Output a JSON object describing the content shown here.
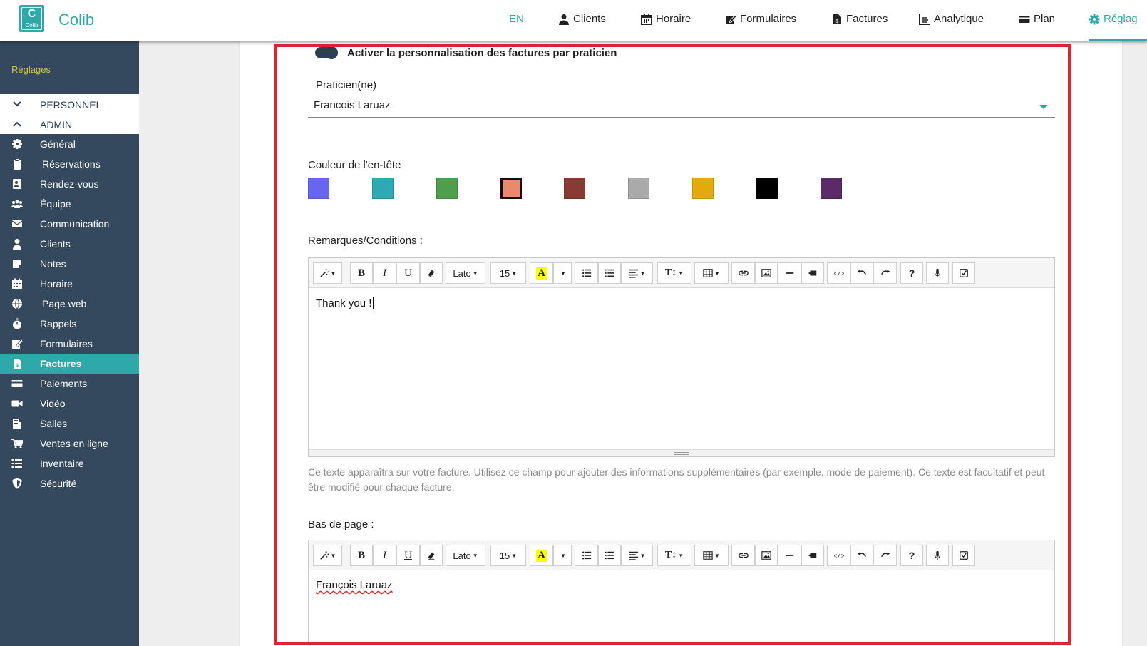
{
  "app": {
    "brand": "Colib",
    "logo_letter": "C",
    "logo_text": "Colib",
    "accent": "#2ea8a9",
    "sidebar_bg": "#34495e",
    "highlight_border": "#e0232e"
  },
  "nav": {
    "lang": "EN",
    "items": [
      {
        "label": "Clients",
        "icon": "user-icon"
      },
      {
        "label": "Horaire",
        "icon": "calendar-icon"
      },
      {
        "label": "Formulaires",
        "icon": "form-edit-icon"
      },
      {
        "label": "Factures",
        "icon": "invoice-icon"
      },
      {
        "label": "Analytique",
        "icon": "chart-line-icon"
      },
      {
        "label": "Plan",
        "icon": "credit-card-icon"
      },
      {
        "label": "Réglag",
        "icon": "gear-icon"
      }
    ]
  },
  "sidebar": {
    "title": "Réglages",
    "groups": [
      {
        "label": "PERSONNEL",
        "icon": "chevron-down-icon"
      },
      {
        "label": "ADMIN",
        "icon": "chevron-up-icon"
      }
    ],
    "items": [
      {
        "label": "Général",
        "icon": "gear-icon"
      },
      {
        "label": "Réservations",
        "icon": "clipboard-icon"
      },
      {
        "label": "Rendez-vous",
        "icon": "address-card-icon"
      },
      {
        "label": "Équipe",
        "icon": "users-icon"
      },
      {
        "label": "Communication",
        "icon": "envelope-icon"
      },
      {
        "label": "Clients",
        "icon": "user-icon"
      },
      {
        "label": "Notes",
        "icon": "note-icon"
      },
      {
        "label": "Horaire",
        "icon": "calendar-icon"
      },
      {
        "label": "Page web",
        "icon": "globe-icon"
      },
      {
        "label": "Rappels",
        "icon": "stopwatch-icon"
      },
      {
        "label": "Formulaires",
        "icon": "form-edit-icon"
      },
      {
        "label": "Factures",
        "icon": "invoice-icon"
      },
      {
        "label": "Paiements",
        "icon": "credit-card-icon"
      },
      {
        "label": "Vidéo",
        "icon": "video-icon"
      },
      {
        "label": "Salles",
        "icon": "building-icon"
      },
      {
        "label": "Ventes en ligne",
        "icon": "cart-icon"
      },
      {
        "label": "Inventaire",
        "icon": "list-ol-icon"
      },
      {
        "label": "Sécurité",
        "icon": "shield-icon"
      }
    ],
    "active_item": "Factures"
  },
  "form": {
    "toggle_label": "Activer la personnalisation des factures par praticien",
    "toggle_on": true,
    "practitioner_label": "Praticien(ne)",
    "practitioner_value": "Francois Laruaz",
    "header_color_label": "Couleur de l'en-tête",
    "colors": [
      "#6666ee",
      "#2ea8b2",
      "#4ca04c",
      "#e98a6e",
      "#8b3a33",
      "#aaaaaa",
      "#e4aa0c",
      "#000000",
      "#5c2a66"
    ],
    "selected_color_index": 3,
    "remarks_label": "Remarques/Conditions :",
    "remarks_text": "Thank you !",
    "remarks_help": "Ce texte apparaîtra sur votre facture. Utilisez ce champ pour ajouter des informations supplémentaires (par exemple, mode de paiement). Ce texte est facultatif et peut être modifié pour chaque facture.",
    "footer_label": "Bas de page :",
    "footer_text": "François Laruaz"
  },
  "toolbar": {
    "font": "Lato",
    "size": "15",
    "buttons": [
      "magic-icon",
      "bold-icon",
      "italic-icon",
      "underline-icon",
      "eraser-icon",
      "font-select",
      "size-select",
      "highlight-icon",
      "highlight-dropdown",
      "unordered-list-icon",
      "ordered-list-icon",
      "align-icon",
      "text-height-icon",
      "table-icon",
      "link-icon",
      "image-icon",
      "horizontal-rule-icon",
      "video-embed-icon",
      "code-view-icon",
      "undo-icon",
      "redo-icon",
      "help-icon",
      "microphone-icon",
      "spellcheck-icon"
    ]
  }
}
